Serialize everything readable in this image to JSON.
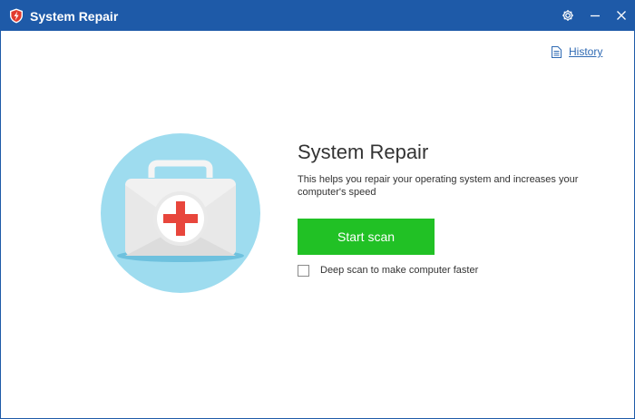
{
  "window": {
    "title": "System Repair",
    "app_icon": "shield-icon",
    "buttons": {
      "settings_icon": "gear-icon",
      "minimize_icon": "minimize-icon",
      "close_icon": "close-icon"
    }
  },
  "history": {
    "label": "History",
    "icon": "document-icon"
  },
  "main": {
    "illustration": "first-aid-kit-icon",
    "heading": "System Repair",
    "description": "This helps you repair your operating system and increases your computer's speed",
    "start_button_label": "Start scan",
    "deep_scan": {
      "label": "Deep scan to make computer faster",
      "checked": false
    }
  },
  "colors": {
    "titlebar": "#1e5aa8",
    "accent_green": "#21c125",
    "link": "#2f6ab3",
    "illustration_circle": "#9edcef",
    "cross_red": "#e8463c"
  }
}
